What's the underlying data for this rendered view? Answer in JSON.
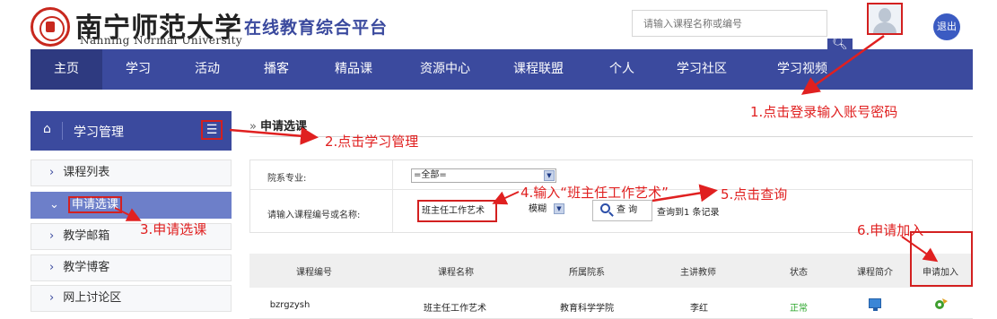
{
  "header": {
    "logo_cn": "南宁师范大学",
    "logo_en": "Nanning Normal University",
    "platform_name": "在线教育综合平台",
    "search_placeholder": "请输入课程名称或编号",
    "search_icon": "search-icon",
    "logout_label": "退出"
  },
  "nav": {
    "items": [
      "主页",
      "学习",
      "活动",
      "播客",
      "精品课",
      "资源中心",
      "课程联盟",
      "个人",
      "学习社区",
      "学习视频"
    ],
    "active_index": 0
  },
  "sidebar": {
    "title": "学习管理",
    "items": [
      {
        "label": "课程列表",
        "active": false
      },
      {
        "label": "申请选课",
        "active": true
      },
      {
        "label": "教学邮箱",
        "active": false
      },
      {
        "label": "教学博客",
        "active": false
      },
      {
        "label": "网上讨论区",
        "active": false
      }
    ]
  },
  "main": {
    "breadcrumb": "申请选课",
    "form": {
      "dept_label": "院系专业:",
      "dept_value": "=全部=",
      "keyword_label": "请输入课程编号或名称:",
      "keyword_value": "班主任工作艺术",
      "mode_value": "模糊",
      "query_button": "查 询",
      "result_text": "查询到1 条记录"
    },
    "table": {
      "headers": [
        "课程编号",
        "课程名称",
        "所属院系",
        "主讲教师",
        "状态",
        "课程简介",
        "申请加入"
      ],
      "rows": [
        {
          "code": "bzrgzysh",
          "name": "班主任工作艺术",
          "dept": "教育科学学院",
          "teacher": "李红",
          "status": "正常"
        }
      ]
    }
  },
  "annotations": {
    "step1": "1.点击登录输入账号密码",
    "step2": "2.点击学习管理",
    "step3": "3.申请选课",
    "step4": "4.输入“班主任工作艺术”",
    "step5": "5.点击查询",
    "step6": "6.申请加入"
  },
  "colors": {
    "brand": "#3b4a9e",
    "annotation": "#e02020",
    "status_ok": "#2aa52a"
  }
}
